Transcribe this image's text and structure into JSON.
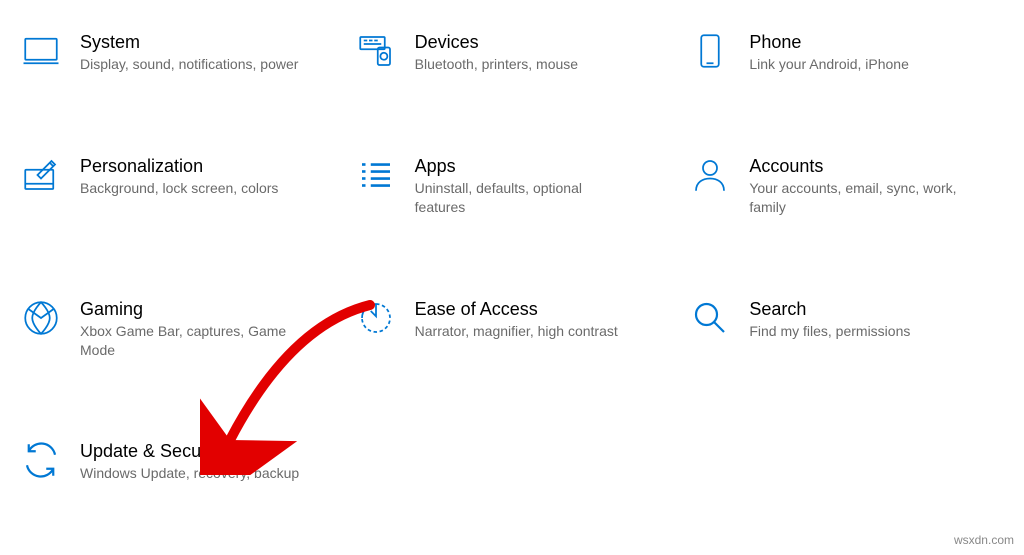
{
  "settings": {
    "items": [
      {
        "key": "system",
        "title": "System",
        "desc": "Display, sound, notifications, power"
      },
      {
        "key": "devices",
        "title": "Devices",
        "desc": "Bluetooth, printers, mouse"
      },
      {
        "key": "phone",
        "title": "Phone",
        "desc": "Link your Android, iPhone"
      },
      {
        "key": "personalization",
        "title": "Personalization",
        "desc": "Background, lock screen, colors"
      },
      {
        "key": "apps",
        "title": "Apps",
        "desc": "Uninstall, defaults, optional features"
      },
      {
        "key": "accounts",
        "title": "Accounts",
        "desc": "Your accounts, email, sync, work, family"
      },
      {
        "key": "gaming",
        "title": "Gaming",
        "desc": "Xbox Game Bar, captures, Game Mode"
      },
      {
        "key": "ease-of-access",
        "title": "Ease of Access",
        "desc": "Narrator, magnifier, high contrast"
      },
      {
        "key": "search",
        "title": "Search",
        "desc": "Find my files, permissions"
      },
      {
        "key": "update-security",
        "title": "Update & Security",
        "desc": "Windows Update, recovery, backup"
      }
    ]
  },
  "watermark": "wsxdn.com",
  "colors": {
    "accent": "#0078d4",
    "text": "#000000",
    "muted": "#6a6a6a",
    "arrow": "#e20000"
  }
}
